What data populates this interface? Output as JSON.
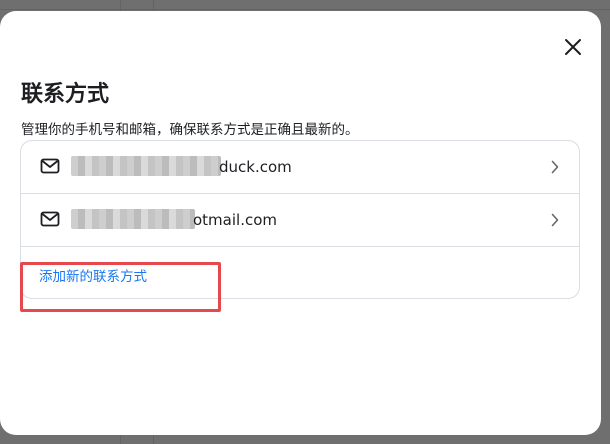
{
  "dialog": {
    "title": "联系方式",
    "subtitle": "管理你的手机号和邮箱，确保联系方式是正确且最新的。",
    "close_icon": "close-icon"
  },
  "contacts": [
    {
      "icon": "mail-icon",
      "visible_text": "duck.com",
      "redacted": true
    },
    {
      "icon": "mail-icon",
      "visible_text": "otmail.com",
      "redacted": true
    }
  ],
  "add_contact_label": "添加新的联系方式",
  "colors": {
    "link": "#1877f2",
    "highlight": "#e5484d",
    "border": "#dadde1",
    "text": "#1c1e21"
  }
}
